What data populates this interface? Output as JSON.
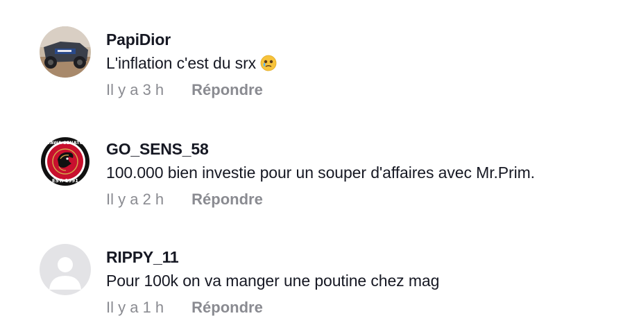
{
  "comments": [
    {
      "username": "PapiDior",
      "text": "L'inflation c'est du srx",
      "emoji": "face-holding-back-tears-icon",
      "time": "Il y a 3 h",
      "reply_label": "Répondre"
    },
    {
      "username": "GO_SENS_58",
      "text": "100.000 bien investie pour un souper d'affaires avec Mr.Prim.",
      "time": "Il y a 2 h",
      "reply_label": "Répondre",
      "avatar_badge_top": "OTTAWA SENATORS",
      "avatar_badge_bottom": "EST. 1991"
    },
    {
      "username": "RIPPY_11",
      "text": "Pour 100k on va manger une poutine chez mag",
      "time": "Il y a 1 h",
      "reply_label": "Répondre"
    }
  ],
  "colors": {
    "text": "#161823",
    "muted": "#8a8b91",
    "senators_red": "#c8102e",
    "default_avatar_bg": "#e3e3e6"
  }
}
